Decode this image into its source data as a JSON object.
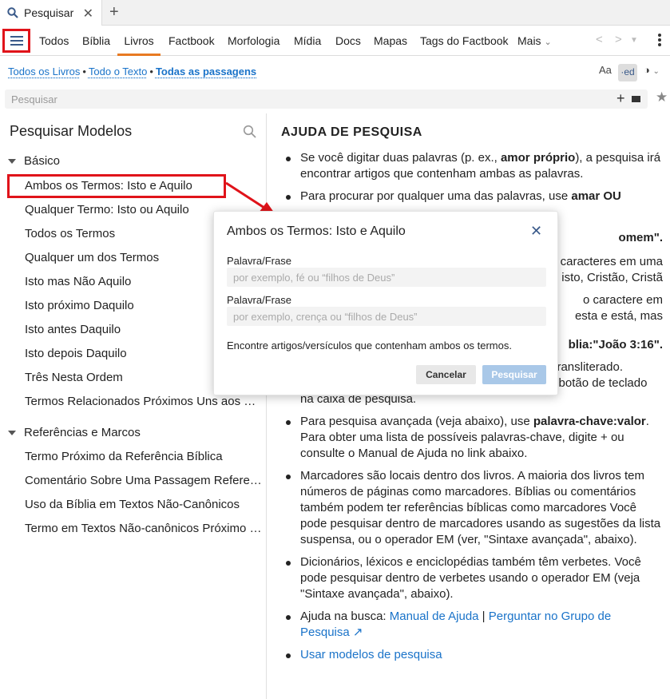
{
  "tab": {
    "icon": "search-icon",
    "label": "Pesquisar",
    "close_icon": "close-icon",
    "add_icon": "plus-icon"
  },
  "menu": {
    "items": [
      "Todos",
      "Bíblia",
      "Livros",
      "Factbook",
      "Morfologia",
      "Mídia",
      "Docs",
      "Mapas",
      "Tags do Factbook",
      "Mais"
    ],
    "active": "Livros",
    "accent": "#e87a22"
  },
  "breadcrumb": {
    "items": [
      "Todos os Livros",
      "Todo o Texto",
      "Todas as passagens"
    ],
    "separator": "•"
  },
  "tools": {
    "font_size": "Aa",
    "edit": "·ed"
  },
  "search": {
    "placeholder": "Pesquisar",
    "value": ""
  },
  "templates": {
    "title": "Pesquisar Modelos",
    "sections": [
      {
        "name": "Básico",
        "items": [
          "Ambos os Termos: Isto e Aquilo",
          "Qualquer Termo: Isto ou Aquilo",
          "Todos os Termos",
          "Qualquer um dos Termos",
          "Isto mas Não Aquilo",
          "Isto próximo Daquilo",
          "Isto antes Daquilo",
          "Isto depois Daquilo",
          "Três Nesta Ordem",
          "Termos Relacionados Próximos Uns aos Outros"
        ]
      },
      {
        "name": "Referências e Marcos",
        "items": [
          "Termo Próximo da Referência Bíblica",
          "Comentário Sobre Uma Passagem Referenciada",
          "Uso da Bíblia em Textos Não-Canônicos",
          "Termo em Textos Não-canônicos Próximo da Referência Bíblica"
        ]
      }
    ]
  },
  "help": {
    "title": "AJUDA DE PESQUISA",
    "b1_pre": "Se você digitar duas palavras (p. ex., ",
    "b1_bold": "amor próprio",
    "b1_post": "), a pesquisa irá encontrar artigos que contenham ambas as palavras.",
    "b2_pre": "Para procurar por qualquer uma das palavras, use ",
    "b2_bold": "amar OU",
    "b3_tail": "omem\".",
    "b4_l1": "caracteres em uma",
    "b4_l2": "isto, Cristão, Cristã",
    "b5_l1": "o caractere em",
    "b5_l2": "esta e está, mas",
    "b6_tail": "blia:\"João 3:16\".",
    "b7_l1": "ransliterado.",
    "b7_l2": "Mude para um teclado grego ou hebraico com o botão de teclado na caixa de pesquisa.",
    "b8_pre": "Para pesquisa avançada (veja abaixo), use ",
    "b8_bold": "palavra-chave:valor",
    "b8_post": ". Para obter uma lista de possíveis palavras-chave, digite + ou consulte o Manual de Ajuda no link abaixo.",
    "b9": "Marcadores são locais dentro dos livros. A maioria dos livros tem números de páginas como marcadores. Bíblias ou comentários também podem ter referências bíblicas como marcadores Você pode pesquisar dentro de marcadores usando as sugestões da lista suspensa, ou o operador EM (ver, \"Sintaxe avançada\", abaixo).",
    "b10": "Dicionários, léxicos e enciclopédias também têm verbetes. Você pode pesquisar dentro de verbetes usando o operador EM (veja \"Sintaxe avançada\", abaixo).",
    "b11_pre": "Ajuda na busca: ",
    "b11_link1": "Manual de Ajuda",
    "b11_sep": " | ",
    "b11_link2": "Perguntar no Grupo de Pesquisa",
    "b12_link": "Usar modelos de pesquisa",
    "link_color": "#1a73c9"
  },
  "modal": {
    "title": "Ambos os Termos: Isto e Aquilo",
    "field1_label": "Palavra/Frase",
    "field1_placeholder": "por exemplo, fé ou “filhos de Deus”",
    "field2_label": "Palavra/Frase",
    "field2_placeholder": "por exemplo, crença ou “filhos de Deus”",
    "note": "Encontre artigos/versículos que contenham ambos os termos.",
    "cancel": "Cancelar",
    "search": "Pesquisar"
  },
  "annotation_color": "#e0131a"
}
